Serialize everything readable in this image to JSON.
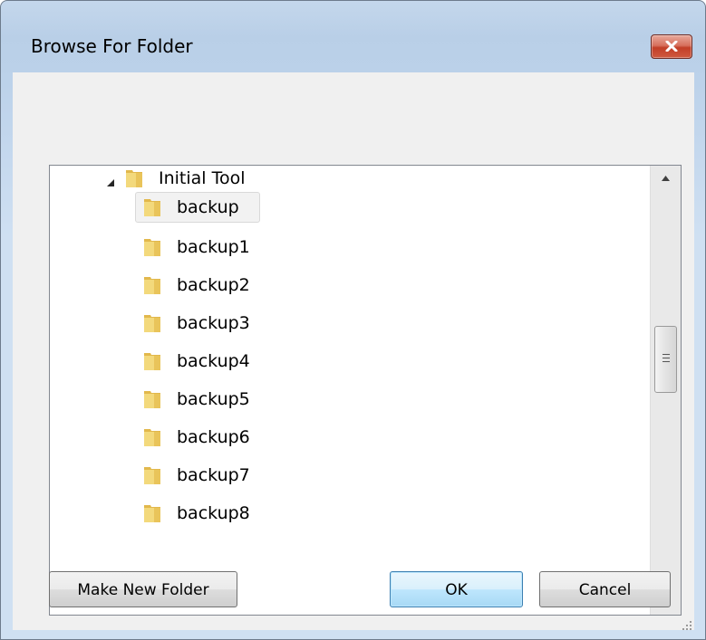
{
  "window": {
    "title": "Browse For Folder"
  },
  "tree": {
    "root": {
      "label": "Initial Tool",
      "expanded": true
    },
    "items": [
      {
        "label": "backup",
        "selected": true
      },
      {
        "label": "backup1"
      },
      {
        "label": "backup2"
      },
      {
        "label": "backup3"
      },
      {
        "label": "backup4"
      },
      {
        "label": "backup5"
      },
      {
        "label": "backup6"
      },
      {
        "label": "backup7"
      },
      {
        "label": "backup8"
      }
    ]
  },
  "buttons": {
    "make_new_folder": "Make New Folder",
    "ok": "OK",
    "cancel": "Cancel"
  },
  "icons": {
    "close": "close-icon",
    "folder": "folder-icon",
    "expander": "expanded-triangle-icon",
    "scroll_up": "scroll-up-arrow-icon",
    "scroll_down": "scroll-down-arrow-icon"
  },
  "colors": {
    "frame": "#c4d7ec",
    "close_button": "#c23e27",
    "default_button_border": "#3c7fb1",
    "folder": "#e8c768"
  }
}
